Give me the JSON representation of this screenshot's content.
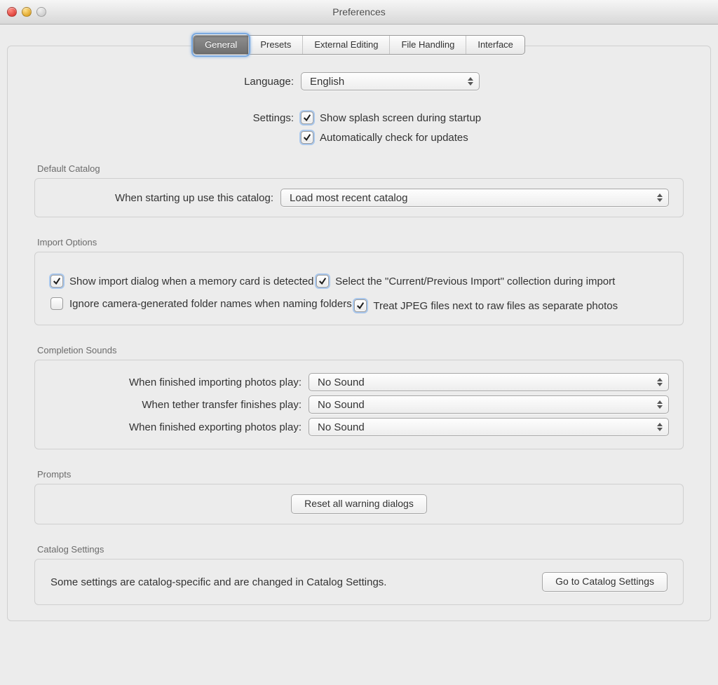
{
  "window": {
    "title": "Preferences"
  },
  "tabs": [
    {
      "label": "General",
      "selected": true
    },
    {
      "label": "Presets",
      "selected": false
    },
    {
      "label": "External Editing",
      "selected": false
    },
    {
      "label": "File Handling",
      "selected": false
    },
    {
      "label": "Interface",
      "selected": false
    }
  ],
  "general": {
    "language_label": "Language:",
    "language_value": "English",
    "settings_label": "Settings:",
    "settings_opts": {
      "splash": "Show splash screen during startup",
      "updates": "Automatically check for updates"
    }
  },
  "default_catalog": {
    "title": "Default Catalog",
    "row_label": "When starting up use this catalog:",
    "value": "Load most recent catalog"
  },
  "import_options": {
    "title": "Import Options",
    "items": {
      "show_dialog": "Show import dialog when a memory card is detected",
      "select_coll": "Select the \"Current/Previous Import\" collection during import",
      "ignore_cam": "Ignore camera-generated folder names when naming folders",
      "jpeg_sep": "Treat JPEG files next to raw files as separate photos"
    }
  },
  "completion_sounds": {
    "title": "Completion Sounds",
    "rows": {
      "import_lbl": "When finished importing photos play:",
      "tether_lbl": "When tether transfer finishes play:",
      "export_lbl": "When finished exporting photos play:"
    },
    "value": "No Sound"
  },
  "prompts": {
    "title": "Prompts",
    "reset_btn": "Reset all warning dialogs"
  },
  "catalog_settings": {
    "title": "Catalog Settings",
    "text": "Some settings are catalog-specific and are changed in Catalog Settings.",
    "btn": "Go to Catalog Settings"
  }
}
